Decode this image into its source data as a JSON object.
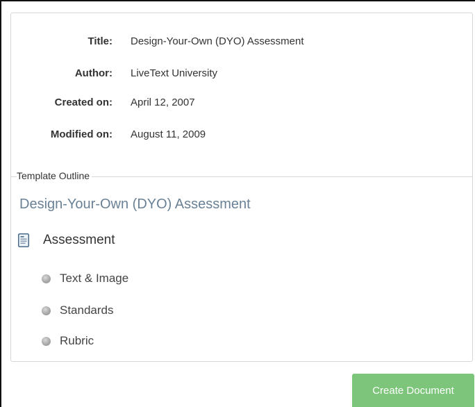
{
  "meta": {
    "title_label": "Title:",
    "title_value": "Design-Your-Own (DYO) Assessment",
    "author_label": "Author:",
    "author_value": "LiveText University",
    "created_label": "Created on:",
    "created_value": "April 12, 2007",
    "modified_label": "Modified on:",
    "modified_value": "August 11, 2009"
  },
  "outline": {
    "legend": "Template Outline",
    "document_title": "Design-Your-Own (DYO) Assessment",
    "section": {
      "label": "Assessment",
      "icon": "document-icon"
    },
    "items": [
      {
        "label": "Text & Image",
        "icon": "gray-bullet-icon"
      },
      {
        "label": "Standards",
        "icon": "gray-bullet-icon"
      },
      {
        "label": "Rubric",
        "icon": "gray-bullet-icon"
      }
    ]
  },
  "actions": {
    "create_label": "Create Document"
  },
  "colors": {
    "accent_green": "#7cc57a",
    "title_blue": "#6a8195",
    "border": "#d6d6d6"
  }
}
